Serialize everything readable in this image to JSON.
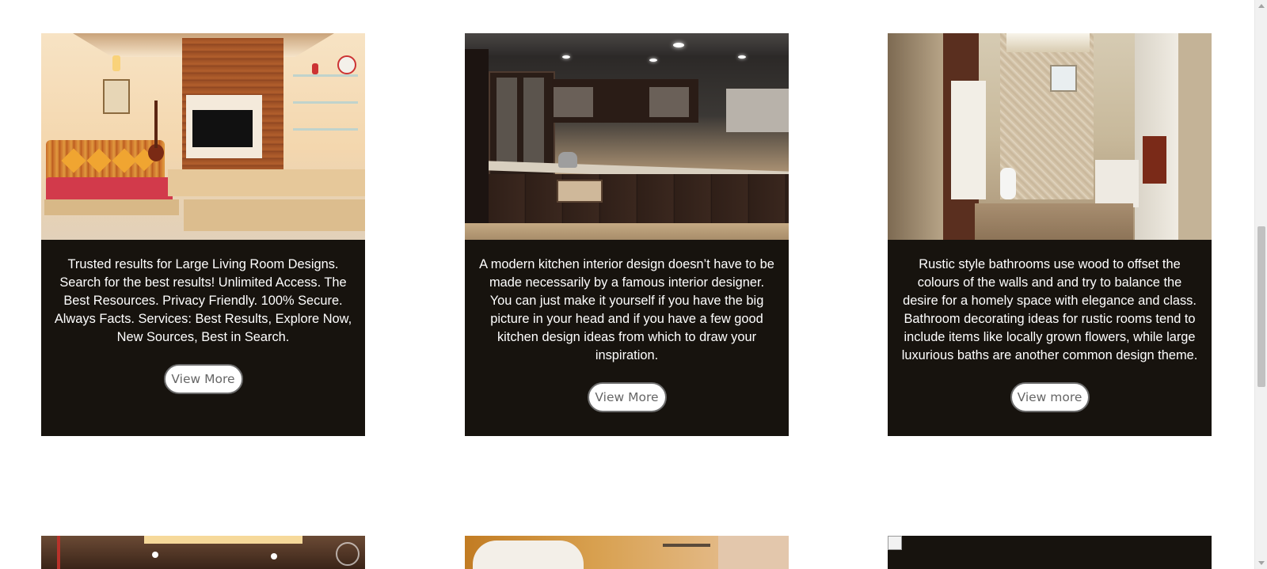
{
  "cards": [
    {
      "image_alt": "living-room-photo",
      "description": "Trusted results for Large Living Room Designs. Search for the best results! Unlimited Access. The Best Resources. Privacy Friendly. 100% Secure. Always Facts. Services: Best Results, Explore Now, New Sources, Best in Search.",
      "button_label": "View More"
    },
    {
      "image_alt": "kitchen-photo",
      "description": "A modern kitchen interior design doesn’t have to be made necessarily by a famous interior designer. You can just make it yourself if you have the big picture in your head and if you have a few good kitchen design ideas from which to draw your inspiration.",
      "button_label": "View More"
    },
    {
      "image_alt": "bathroom-photo",
      "description": "Rustic style bathrooms use wood to offset the colours of the walls and and try to balance the desire for a homely space with elegance and class. Bathroom decorating ideas for rustic rooms tend to include items like locally grown flowers, while large luxurious baths are another common design theme.",
      "button_label": "View more"
    }
  ],
  "colors": {
    "card_background": "#17130e",
    "card_text": "#ffffff",
    "button_background": "#ffffff",
    "button_text": "#666666",
    "page_background": "#ffffff"
  }
}
